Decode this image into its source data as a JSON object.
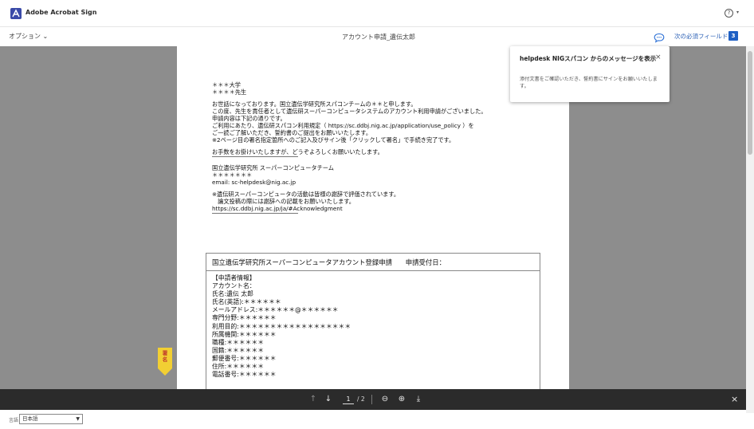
{
  "app": {
    "title": "Adobe Acrobat Sign"
  },
  "header": {
    "help_icon_glyph": "?",
    "help_caret": "▾"
  },
  "subbar": {
    "options_label": "オプション ⌄",
    "document_title": "アカウント申請_遺伝太郎",
    "next_field_label": "次の必須フィールド",
    "next_field_count": "3"
  },
  "popup": {
    "title": "helpdesk NIGスパコン からのメッセージを表示",
    "close": "×",
    "body": "添付文書をご確認いただき、誓約書にサインをお願いいたします。"
  },
  "letter": {
    "lines": [
      "＊＊＊大学",
      "＊＊＊＊先生",
      "",
      "お世話になっております。国立遺伝学研究所スパコンチームの＊＊と申します。",
      "この度、先生を責任者として遺伝研スーパーコンピュータシステムのアカウント利用申請がございました。",
      "申請内容は下記の通りです。",
      "ご利用にあたり、遺伝研スパコン利用規定（ https://sc.ddbj.nig.ac.jp/application/use_policy ）を",
      "ご一読ご了解いただき、誓約書のご提出をお願いいたします。",
      "※2ページ目の署名指定箇所へのご記入及びサイン後「クリックして署名」で手続き完了です。",
      "",
      "お手数をお掛けいたしますが、どうぞよろしくお願いいたします。",
      "---RULE---",
      "国立遺伝学研究所 スーパーコンピュータチーム",
      "＊＊＊＊＊＊＊",
      "email: sc-helpdesk@nig.ac.jp",
      "",
      "※遺伝研スーパーコンピュータの活動は皆様の謝辞で評価されています。",
      "　論文投稿の際には謝辞への記載をお願いいたします。",
      "https://sc.ddbj.nig.ac.jp/ja/#Acknowledgment",
      "---RULE---"
    ]
  },
  "form": {
    "header": "国立遺伝学研究所スーパーコンピュータアカウント登録申請　　申請受付日：",
    "lines": [
      "【申請者情報】",
      "アカウント名：",
      "氏名:遺伝 太郎",
      "氏名(英語):＊＊＊＊＊＊",
      "メールアドレス:＊＊＊＊＊＊@＊＊＊＊＊＊",
      "専門分野:＊＊＊＊＊＊",
      "利用目的:＊＊＊＊＊＊＊＊＊＊＊＊＊＊＊＊＊＊",
      "所属機関:＊＊＊＊＊＊",
      "職種:＊＊＊＊＊＊",
      "国籍:＊＊＊＊＊＊",
      "郵便番号:＊＊＊＊＊＊",
      "住所:＊＊＊＊＊＊",
      "電話番号:＊＊＊＊＊＊"
    ]
  },
  "sign_tag": {
    "label": "署名"
  },
  "toolbar": {
    "prev_page": "↑",
    "next_page": "↓",
    "current_page": "1",
    "total_pages": "/ 2",
    "zoom_out": "⊖",
    "zoom_in": "⊕",
    "download": "⤓",
    "close": "×"
  },
  "footer": {
    "language_label": "言語",
    "language_value": "日本語"
  },
  "colors": {
    "accent": "#1f60c4",
    "viewer_bg": "#8d8d8d",
    "toolbar_bg": "#2b2b2b",
    "sign_tag": "#f2cf33"
  }
}
